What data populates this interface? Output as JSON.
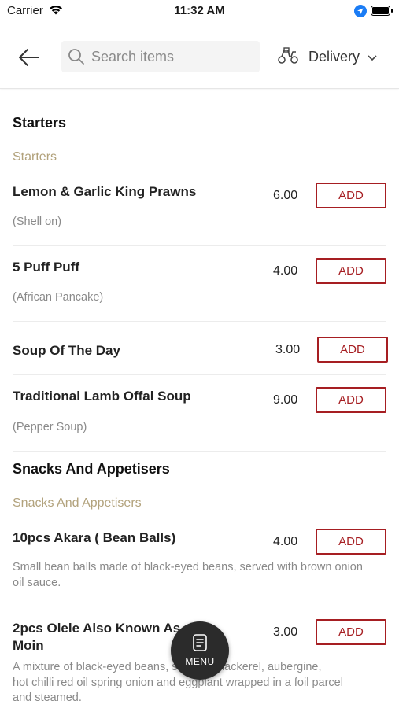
{
  "status_bar": {
    "carrier": "Carrier",
    "time": "11:32 AM"
  },
  "header": {
    "search_placeholder": "Search items",
    "delivery_label": "Delivery"
  },
  "sections": [
    {
      "title": "Starters",
      "subtitle": "Starters",
      "items": [
        {
          "name": "Lemon & Garlic King Prawns",
          "price": "6.00",
          "desc": "(Shell on)",
          "add": "ADD"
        },
        {
          "name": "5 Puff Puff",
          "price": "4.00",
          "desc": "(African Pancake)",
          "add": "ADD"
        },
        {
          "name": "Soup Of The Day",
          "price": "3.00",
          "desc": "",
          "add": "ADD"
        },
        {
          "name": "Traditional Lamb Offal Soup",
          "price": "9.00",
          "desc": "(Pepper Soup)",
          "add": "ADD"
        }
      ]
    },
    {
      "title": "Snacks And Appetisers",
      "subtitle": "Snacks And Appetisers",
      "items": [
        {
          "name": "10pcs Akara ( Bean Balls)",
          "price": "4.00",
          "desc": "Small bean balls made of black-eyed beans, served with brown onion oil sauce.",
          "add": "ADD"
        },
        {
          "name": "2pcs Olele Also Known As Moin Moin",
          "name_line1": "2pcs Olele Also Known As",
          "name_line2": "Moin",
          "price": "3.00",
          "desc_line1": "A mixture of black-eyed beans, smoked mackerel, aubergine,",
          "desc_line2": "hot chilli red oil spring onion and eggplant wrapped in a foil parcel",
          "desc_line3": "and steamed.",
          "add": "ADD"
        }
      ]
    }
  ],
  "menu_fab": {
    "label": "MENU"
  },
  "colors": {
    "accent": "#a61e22",
    "subtitle": "#b2a27c",
    "fab": "#2b2b2b"
  }
}
